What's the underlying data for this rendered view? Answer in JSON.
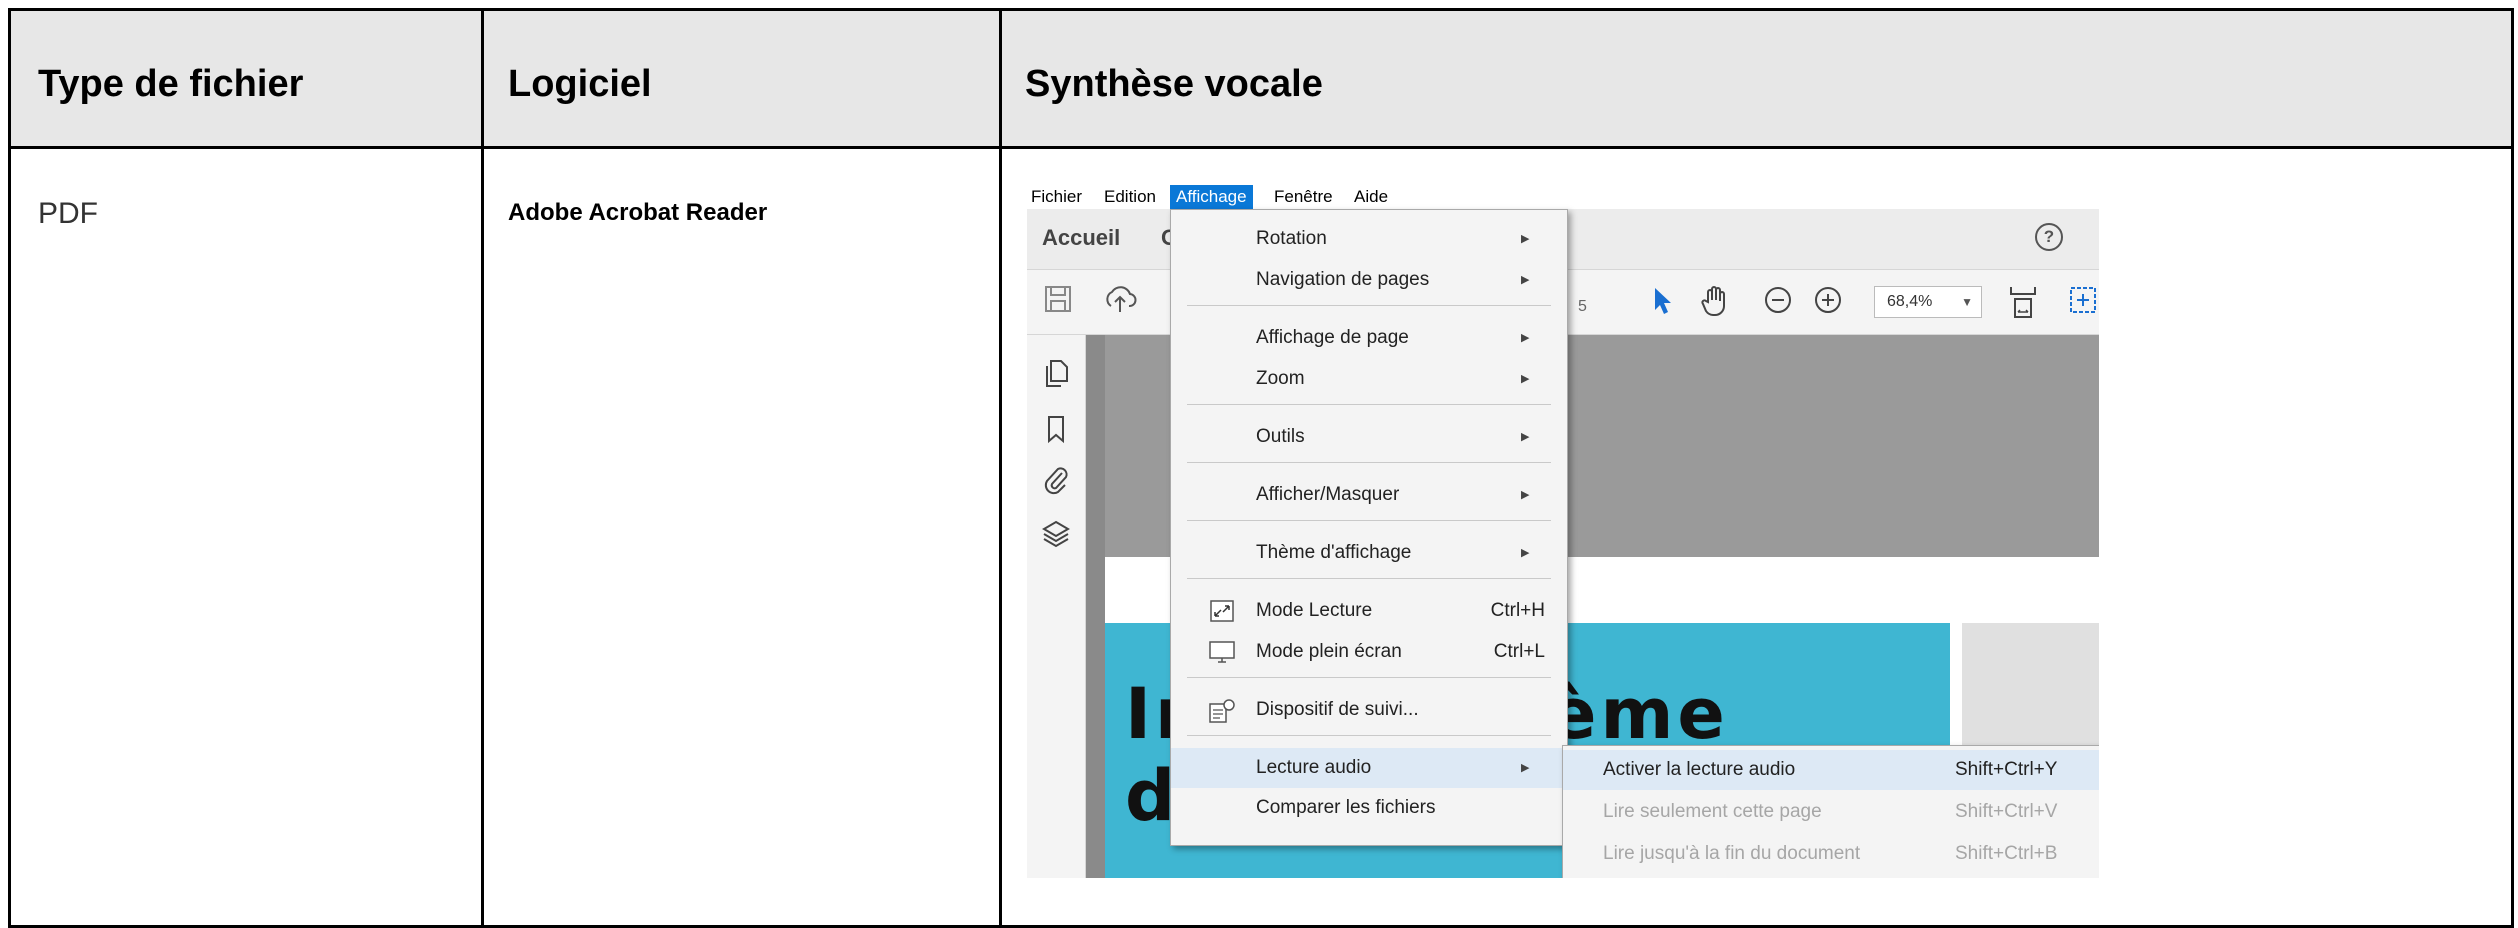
{
  "table": {
    "headers": [
      "Type de fichier",
      "Logiciel",
      "Synthèse vocale"
    ],
    "row": {
      "file_type": "PDF",
      "software": "Adobe Acrobat Reader"
    }
  },
  "acrobat": {
    "menubar": [
      "Fichier",
      "Edition",
      "Affichage",
      "Fenêtre",
      "Aide"
    ],
    "active_menu": "Affichage",
    "tabs": {
      "home": "Accueil",
      "second_partial": "O"
    },
    "help_icon": "?",
    "zoom": "68,4%",
    "page_number_partial": "5",
    "page_title_line1": "Im          lu système",
    "page_title_line2": "d",
    "menu_items": [
      {
        "label": "Rotation",
        "submenu": true
      },
      {
        "label": "Navigation de pages",
        "submenu": true
      },
      {
        "label": "Affichage de page",
        "submenu": true
      },
      {
        "label": "Zoom",
        "submenu": true
      },
      {
        "label": "Outils",
        "submenu": true
      },
      {
        "label": "Afficher/Masquer",
        "submenu": true
      },
      {
        "label": "Thème d'affichage",
        "submenu": true
      },
      {
        "label": "Mode Lecture",
        "shortcut": "Ctrl+H",
        "icon": "reading-mode-icon"
      },
      {
        "label": "Mode plein écran",
        "shortcut": "Ctrl+L",
        "icon": "fullscreen-icon"
      },
      {
        "label": "Dispositif de suivi...",
        "icon": "tracker-icon"
      },
      {
        "label": "Lecture audio",
        "submenu": true,
        "highlighted": true
      },
      {
        "label": "Comparer les fichiers"
      }
    ],
    "submenu_items": [
      {
        "label": "Activer la lecture audio",
        "shortcut": "Shift+Ctrl+Y",
        "enabled": true
      },
      {
        "label": "Lire seulement cette page",
        "shortcut": "Shift+Ctrl+V",
        "enabled": false
      },
      {
        "label": "Lire jusqu'à la fin du document",
        "shortcut": "Shift+Ctrl+B",
        "enabled": false
      }
    ],
    "colors": {
      "menu_highlight": "#dde9f5",
      "active_menubar": "#0a78d7",
      "page_cyan": "#3fb6d2"
    }
  }
}
